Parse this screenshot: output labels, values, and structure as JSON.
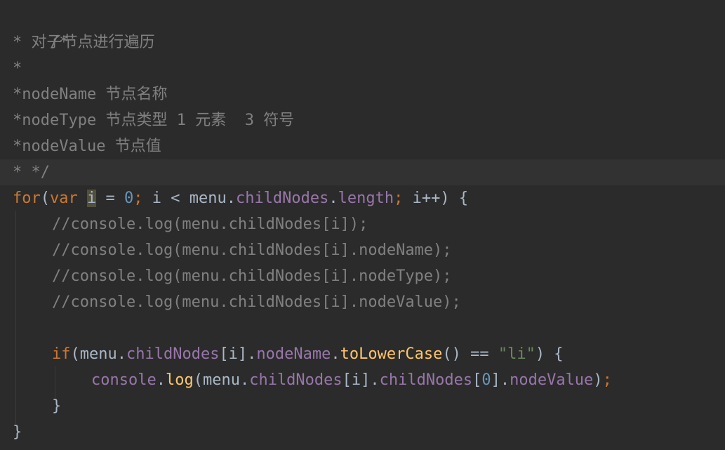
{
  "editor": {
    "comment": {
      "l1": "/*",
      "l2_prefix": "* ",
      "l2_text": "对子节点进行遍历",
      "l3": "*",
      "l4_prefix": "*nodeName ",
      "l4_text": "节点名称",
      "l5_prefix": "*nodeType ",
      "l5_text1": "节点类型",
      "l5_num1": " 1 ",
      "l5_text2": "元素",
      "l5_num2": "  3 ",
      "l5_text3": "符号",
      "l6_prefix": "*nodeValue ",
      "l6_text": "节点值",
      "l7": "* */"
    },
    "for_line": {
      "kw_for": "for",
      "p1": "(",
      "kw_var": "var",
      "sp1": " ",
      "var_i": "i",
      "eq": " = ",
      "zero": "0",
      "semi1": ";",
      "cond": " i < menu.",
      "prop1": "childNodes",
      "dot1": ".",
      "prop2": "length",
      "semi2": ";",
      "incr": " i++) {"
    },
    "log_comments": [
      "//console.log(menu.childNodes[i]);",
      "//console.log(menu.childNodes[i].nodeName);",
      "//console.log(menu.childNodes[i].nodeType);",
      "//console.log(menu.childNodes[i].nodeValue);"
    ],
    "if_line": {
      "kw_if": "if",
      "p1": "(menu.",
      "prop1": "childNodes",
      "idx": "[i].",
      "prop2": "nodeName",
      "dot": ".",
      "fn": "toLowerCase",
      "cmp": "() == ",
      "str": "\"li\"",
      "tail": ") {"
    },
    "console_line": {
      "obj": "console",
      "dot1": ".",
      "fn": "log",
      "p1": "(menu.",
      "prop1": "childNodes",
      "idx": "[i].",
      "prop2": "childNodes",
      "idx0a": "[",
      "zero": "0",
      "idx0b": "].",
      "prop3": "nodeValue",
      "close": ")",
      "semi": ";"
    },
    "close_if": "}",
    "close_for": "}"
  }
}
